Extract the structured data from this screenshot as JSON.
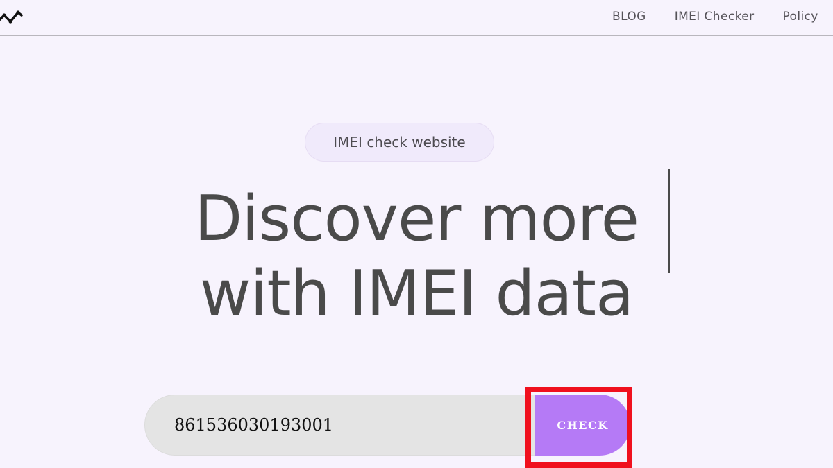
{
  "nav": {
    "logo_icon": "zigzag-logo-icon",
    "links": [
      "BLOG",
      "IMEI Checker",
      "Policy"
    ]
  },
  "hero": {
    "badge": "IMEI check website",
    "headline_line1": "Discover more",
    "headline_line2": "with IMEI data"
  },
  "search": {
    "value": "861536030193001",
    "button_label": "CHECK"
  },
  "colors": {
    "background": "#f7f3fd",
    "accent_button": "#b57af6",
    "highlight_box": "#f0101e",
    "input_bg": "#e4e4e4",
    "text": "#4a4a4a"
  }
}
